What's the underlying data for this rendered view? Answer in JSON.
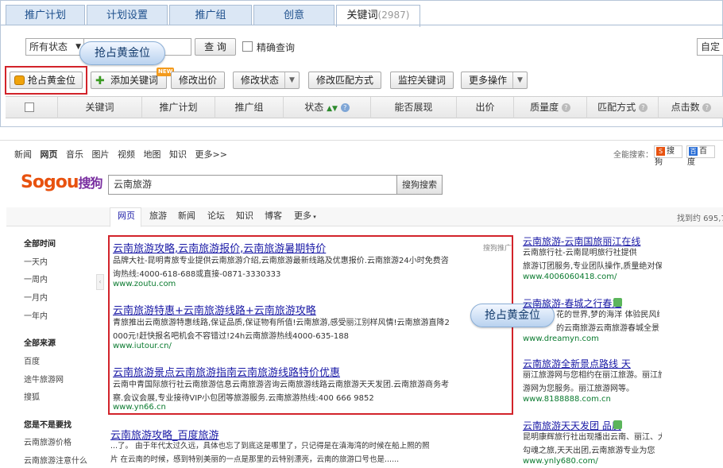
{
  "tabs": [
    {
      "label": "推广计划"
    },
    {
      "label": "计划设置"
    },
    {
      "label": "推广组"
    },
    {
      "label": "创意"
    },
    {
      "label": "关键词",
      "count": "(2987)"
    }
  ],
  "filter": {
    "status_value": "所有状态",
    "query_button": "查 询",
    "exact_label": "精确查询",
    "custom_label": "自定"
  },
  "bubble_label": "抢占黄金位",
  "toolbar": {
    "gold_button": "抢占黄金位",
    "add_keyword": "添加关键词",
    "new_badge": "NEW",
    "modify_price": "修改出价",
    "modify_status": "修改状态",
    "modify_match": "修改匹配方式",
    "monitor": "监控关键词",
    "more_ops": "更多操作"
  },
  "table_headers": [
    "关键词",
    "推广计划",
    "推广组",
    "状态",
    "能否展现",
    "出价",
    "质量度",
    "匹配方式",
    "点击数"
  ],
  "sogou": {
    "top_links": [
      "新闻",
      "网页",
      "音乐",
      "图片",
      "视频",
      "地图",
      "知识",
      "更多>>"
    ],
    "all_search_label": "全能搜索：",
    "engines": [
      "搜狗",
      "百度"
    ],
    "logo_text": "Sogou",
    "logo_cn": "搜狗",
    "query": "云南旅游",
    "search_button": "搜狗搜索",
    "verticals": [
      "网页",
      "旅游",
      "新闻",
      "论坛",
      "知识",
      "博客",
      "更多"
    ],
    "result_count": "找到约 695,7",
    "sidebar": {
      "time_head": "全部时间",
      "times": [
        "一天内",
        "一周内",
        "一月内",
        "一年内"
      ],
      "source_head": "全部来源",
      "sources": [
        "百度",
        "途牛旅游网",
        "搜狐"
      ],
      "find_head": "您是不是要找",
      "finds": [
        "云南旅游价格",
        "云南旅游注意什么"
      ]
    },
    "ad_label": "搜狗推广",
    "ads": [
      {
        "title": "云南旅游攻略,云南旅游报价,云南旅游暑期特价",
        "line1": "品牌大社-昆明青旅专业提供云南旅游介绍,云南旅游最新线路及优惠报价.云南旅游24小时免费咨",
        "line2": "询热线:4000-618-688或直接-0871-3330333",
        "url": "www.zoutu.com"
      },
      {
        "title": "云南旅游特惠+云南旅游线路+云南旅游攻略",
        "line1": "青旅推出云南旅游特惠线路,保证品质,保证物有所值!云南旅游,感受丽江别样风情!云南旅游直降2",
        "line2": "000元!赶快报名吧机会不容错过!24h云南旅游热线4000-635-188",
        "url": "www.iutour.cn/"
      },
      {
        "title": "云南旅游景点云南旅游指南云南旅游线路特价优惠",
        "line1": "云南中青国际旅行社云南旅游信息云南旅游咨询云南旅游线路云南旅游天天发团.云南旅游商务考",
        "line2": "察.会议会展,专业接待VIP小包团等旅游服务.云南旅游热线:400 666 9852",
        "url": "www.yn66.cn"
      }
    ],
    "organic": {
      "title": "云南旅游攻略_百度旅游",
      "line1": "...了。 由于年代太过久远，具体也忘了到底这是哪里了，只记得是在滇海湾的时候在船上照的照",
      "line2": "片 在云南的时候，感到特别美丽的一点是那里的云特别漂亮，云南的旅游口号也是......"
    },
    "right_ads": [
      {
        "title": "云南旅游-云南国旅丽江在线",
        "line1": "云南旅行社-云南昆明旅行社提供",
        "line2": "旅游订团服务,专业团队操作,质量绝对保",
        "url": "www.4006060418.com/"
      },
      {
        "title": "云南旅游-春城之行春之",
        "line1": "花的世界,梦的海洋 体验民风纯",
        "line2": "的云南旅游云南旅游春城全景推荐",
        "url": "www.dreamyn.com"
      },
      {
        "title": "云南旅游全新景点路线 天",
        "line1": "丽江旅游网与您相约在丽江旅游。丽江旅",
        "line2": "游网为您服务。丽江旅游网等。",
        "url": "www.8188888.com.cn"
      },
      {
        "title": "云南旅游天天发团 品质",
        "line1": "昆明康辉旅行社出现播出云南、丽江、大理",
        "line2": "勾魂之旅,天天出团,云南旅游专业为您",
        "url": "www.ynly680.com/"
      }
    ]
  }
}
